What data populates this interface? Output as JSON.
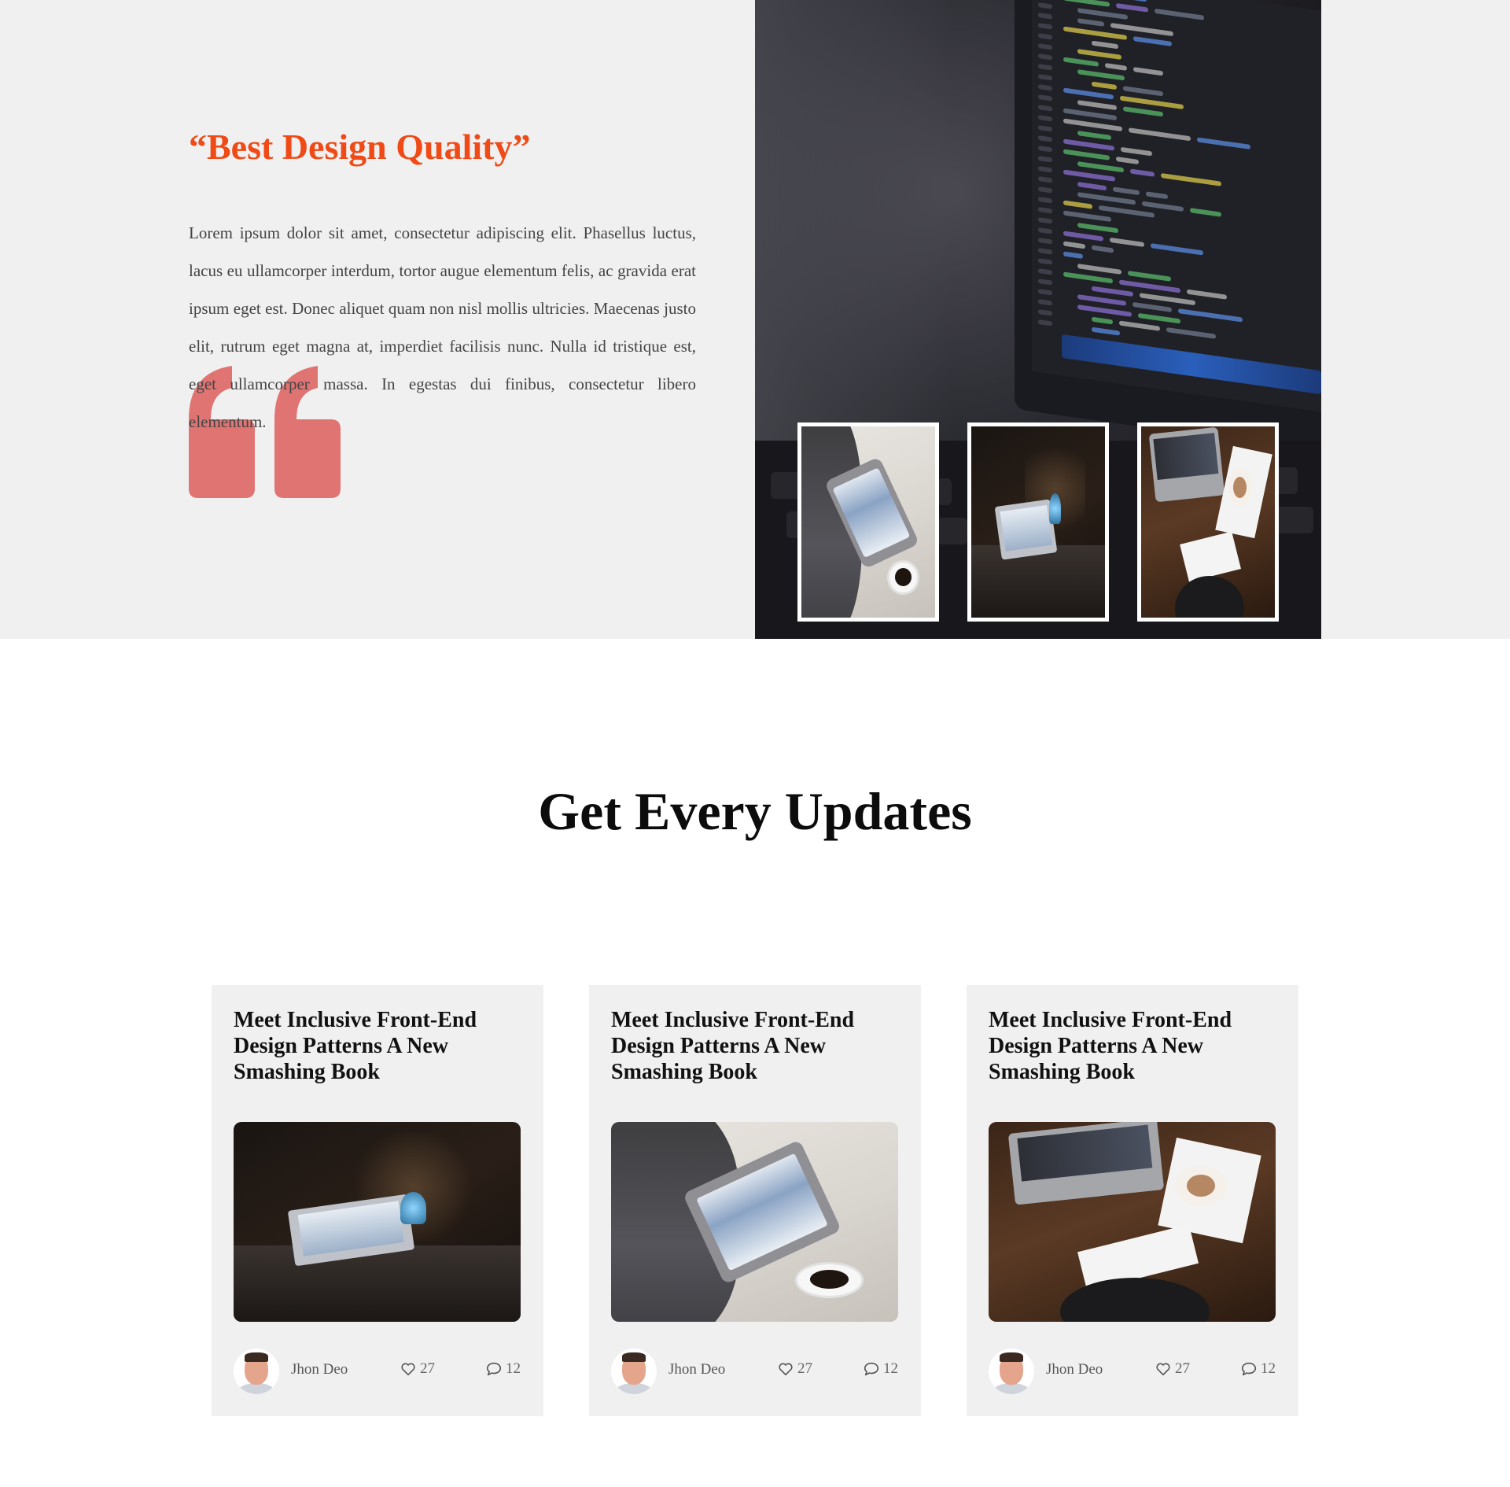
{
  "hero": {
    "title": "“Best Design Quality”",
    "text": "Lorem ipsum dolor sit amet, consectetur adipiscing elit. Phasellus luctus, lacus eu ullamcorper interdum, tortor augue elementum felis, ac gravida erat ipsum eget est. Donec aliquet quam non nisl mollis ultricies. Maecenas justo elit, rutrum eget magna at, imperdiet facilisis nunc. Nulla id tristique est, eget ullamcorper massa. In egestas dui finibus, consectetur libero elementum.",
    "quote_color": "#e07472",
    "accent_color": "#f04a16",
    "background_photo_icon": "monitor-code-photo",
    "thumbnails": [
      {
        "icon": "tablet-coffee-photo"
      },
      {
        "icon": "dark-desk-laptop-photo"
      },
      {
        "icon": "top-view-laptop-photo"
      }
    ]
  },
  "updates": {
    "title": "Get Every Updates",
    "cards": [
      {
        "title": "Meet Inclusive Front-End Design Patterns A New Smashing Book",
        "image": "dark-desk-laptop-photo",
        "author": "Jhon Deo",
        "likes": "27",
        "comments": "12"
      },
      {
        "title": "Meet Inclusive Front-End Design Patterns A New Smashing Book",
        "image": "tablet-coffee-photo",
        "author": "Jhon Deo",
        "likes": "27",
        "comments": "12"
      },
      {
        "title": "Meet Inclusive Front-End Design Patterns A New Smashing Book",
        "image": "top-view-laptop-photo",
        "author": "Jhon Deo",
        "likes": "27",
        "comments": "12"
      }
    ]
  }
}
